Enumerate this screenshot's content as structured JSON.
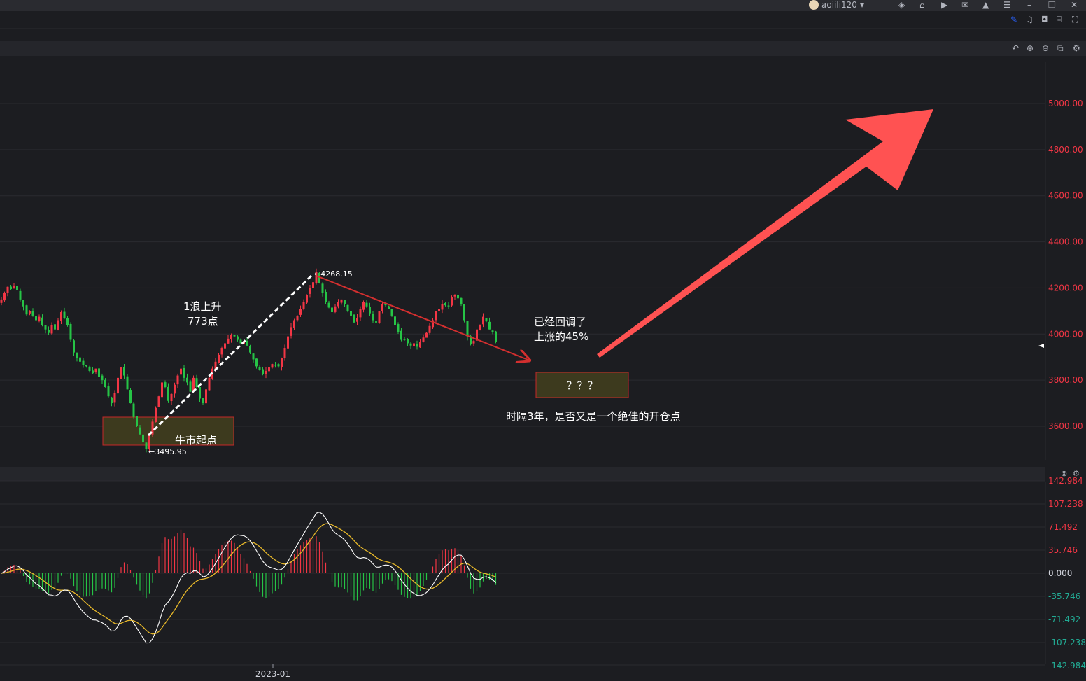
{
  "user": {
    "name": "aoiili120"
  },
  "chart_data": {
    "type": "candlestick",
    "price_axis": {
      "ticks": [
        "5000.00",
        "4800.00",
        "4600.00",
        "4400.00",
        "4200.00",
        "4000.00",
        "3800.00",
        "3600.00"
      ],
      "tick_values": [
        5000,
        4800,
        4600,
        4400,
        4200,
        4000,
        3800,
        3600
      ],
      "range": [
        3480,
        5180
      ]
    },
    "x_axis": {
      "labels": [
        "2023-01"
      ]
    },
    "series_close": [
      4150,
      4180,
      4205,
      4195,
      4210,
      4190,
      4150,
      4120,
      4085,
      4100,
      4080,
      4060,
      4075,
      4040,
      4020,
      4005,
      4040,
      4020,
      4060,
      4095,
      4070,
      4040,
      3975,
      3920,
      3895,
      3880,
      3865,
      3860,
      3840,
      3830,
      3850,
      3815,
      3800,
      3770,
      3730,
      3700,
      3745,
      3810,
      3855,
      3820,
      3760,
      3700,
      3640,
      3600,
      3565,
      3530,
      3500,
      3560,
      3620,
      3680,
      3730,
      3790,
      3770,
      3710,
      3740,
      3780,
      3820,
      3850,
      3810,
      3790,
      3750,
      3810,
      3770,
      3720,
      3700,
      3760,
      3810,
      3850,
      3880,
      3910,
      3940,
      3960,
      3980,
      3995,
      3990,
      3975,
      3960,
      3970,
      3950,
      3920,
      3890,
      3860,
      3845,
      3825,
      3840,
      3855,
      3870,
      3865,
      3860,
      3895,
      3940,
      3990,
      4030,
      4060,
      4080,
      4110,
      4140,
      4170,
      4200,
      4225,
      4268,
      4220,
      4180,
      4140,
      4115,
      4095,
      4120,
      4140,
      4150,
      4130,
      4100,
      4080,
      4050,
      4070,
      4110,
      4140,
      4120,
      4090,
      4060,
      4050,
      4100,
      4130,
      4125,
      4110,
      4080,
      4040,
      4010,
      3975,
      3975,
      3960,
      3950,
      3960,
      3945,
      3965,
      3985,
      4005,
      4035,
      4060,
      4100,
      4110,
      4130,
      4125,
      4120,
      4160,
      4170,
      4155,
      4130,
      4060,
      3990,
      3955,
      3970,
      4020,
      4040,
      4075,
      4055,
      4020,
      4010,
      3965
    ],
    "annotations": {
      "high_label": "←4268.15",
      "low_label": "←3495.95",
      "wave_label_1": "1浪上升",
      "wave_label_2": "773点",
      "retrace_label_1": "已经回调了",
      "retrace_label_2": "上涨的45%",
      "question_box": "？？？",
      "start_box": "牛市起点",
      "bottom_note": "时隔3年，是否又是一个绝佳的开仓点"
    },
    "macd": {
      "ticks": [
        "142.984",
        "107.238",
        "71.492",
        "35.746",
        "0.000",
        "-35.746",
        "-71.492",
        "-107.238",
        "-142.984"
      ],
      "tick_values": [
        142.984,
        107.238,
        71.492,
        35.746,
        0,
        -35.746,
        -71.492,
        -107.238,
        -142.984
      ],
      "tick_colors": [
        "#f23645",
        "#f23645",
        "#f23645",
        "#f23645",
        "#d1d4dc",
        "#22ab94",
        "#22ab94",
        "#22ab94",
        "#22ab94"
      ]
    },
    "colors": {
      "up": "#f23645",
      "down": "#26c446",
      "grid": "#2a2b30",
      "price_tick": "#f23645",
      "arrow": "#ff5252",
      "trend_line": "#d32f2f",
      "box_fill": "#3d3a1e",
      "box_border": "#c62828",
      "dif": "#ffffff",
      "dea": "#e8b92a"
    }
  }
}
